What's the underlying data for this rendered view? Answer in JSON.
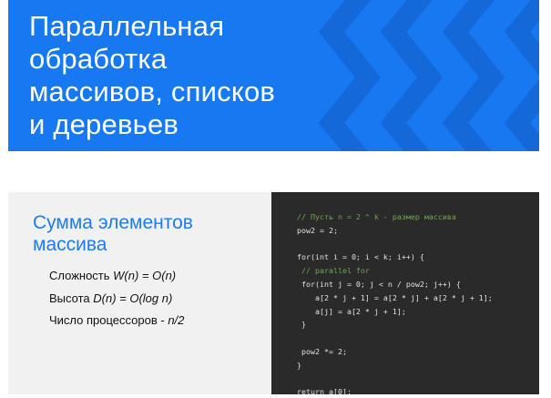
{
  "banner": {
    "title_lines": [
      "Параллельная",
      "обработка",
      "массивов, списков",
      "и деревьев"
    ],
    "background": "#1779f2",
    "decoration": "chevron-pattern"
  },
  "slide": {
    "title_lines": [
      "Сумма элементов",
      "массива"
    ],
    "accent_color": "#1f7bf2",
    "facts": [
      {
        "label": "Сложность ",
        "value": "W(n) = O(n)"
      },
      {
        "label": "Высота ",
        "value": "D(n) = O(log n)"
      },
      {
        "label": "Число процессоров - ",
        "value": "n/2"
      }
    ],
    "code_lines": [
      {
        "text": "// Пусть n = 2 ^ k - размер массива",
        "kind": "comment"
      },
      {
        "text": "pow2 = 2;",
        "kind": "code"
      },
      {
        "text": "",
        "kind": "code"
      },
      {
        "text": "for(int i = 0; i < k; i++) {",
        "kind": "code"
      },
      {
        "text": " // parallel for",
        "kind": "comment"
      },
      {
        "text": " for(int j = 0; j < n / pow2; j++) {",
        "kind": "code"
      },
      {
        "text": "    a[2 * j + 1] = a[2 * j] + a[2 * j + 1];",
        "kind": "code"
      },
      {
        "text": "    a[j] = a[2 * j + 1];",
        "kind": "code"
      },
      {
        "text": " }",
        "kind": "code"
      },
      {
        "text": "",
        "kind": "code"
      },
      {
        "text": " pow2 *= 2;",
        "kind": "code"
      },
      {
        "text": "}",
        "kind": "code"
      },
      {
        "text": "",
        "kind": "code"
      },
      {
        "text": "return a[0];",
        "kind": "code"
      }
    ]
  }
}
